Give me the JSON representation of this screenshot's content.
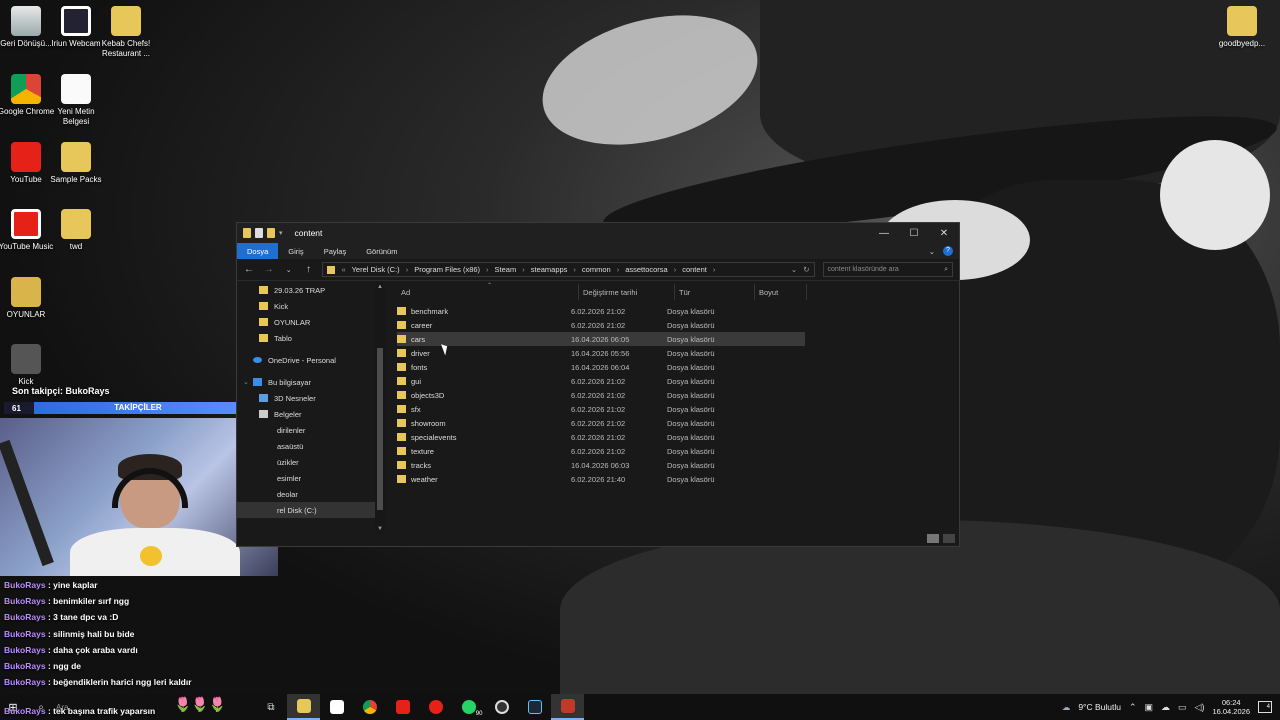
{
  "desktop_icons": [
    {
      "label": "Geri Dönüşü...",
      "icon": "recycle-bin-icon"
    },
    {
      "label": "Iriun Webcam",
      "icon": "webcam-icon"
    },
    {
      "label": "Kebab Chefs! Restaurant ...",
      "icon": "folder-icon"
    },
    {
      "label": "Google Chrome",
      "icon": "chrome-icon"
    },
    {
      "label": "Yeni Metin Belgesi",
      "icon": "text-document-icon"
    },
    {
      "label": "YouTube",
      "icon": "youtube-icon"
    },
    {
      "label": "Sample Packs",
      "icon": "folder-icon"
    },
    {
      "label": "YouTube Music",
      "icon": "youtube-music-icon"
    },
    {
      "label": "twd",
      "icon": "folder-icon"
    },
    {
      "label": "OYUNLAR",
      "icon": "folder-icon"
    },
    {
      "label": "Kick",
      "icon": "kick-icon"
    },
    {
      "label": "goodbyedp...",
      "icon": "folder-icon"
    }
  ],
  "stream_overlay": {
    "follower_title": "Son takipçi: BukoRays",
    "follower_count": "61",
    "follower_label": "TAKİPÇİLER",
    "follower_goal": "100"
  },
  "chat": [
    {
      "user": "BukoRays",
      "msg": ": yine kaplar"
    },
    {
      "user": "BukoRays",
      "msg": ": benimkiler sırf ngg"
    },
    {
      "user": "BukoRays",
      "msg": ": 3 tane dpc va :D"
    },
    {
      "user": "BukoRays",
      "msg": ": silinmiş hali bu bide"
    },
    {
      "user": "BukoRays",
      "msg": ": daha çok araba vardı"
    },
    {
      "user": "BukoRays",
      "msg": ": ngg de"
    },
    {
      "user": "BukoRays",
      "msg": ": beğendiklerin harici ngg leri kaldır"
    },
    {
      "user": "BukoRays",
      "msg": ": bi tane shuto haritası var onu indir"
    },
    {
      "user": "BukoRays",
      "msg": ": tek başına trafik yaparsın"
    }
  ],
  "explorer": {
    "title": "content",
    "ribbon_tabs": [
      "Dosya",
      "Giriş",
      "Paylaş",
      "Görünüm"
    ],
    "path": [
      "Yerel Disk (C:)",
      "Program Files (x86)",
      "Steam",
      "steamapps",
      "common",
      "assettocorsa",
      "content"
    ],
    "search_placeholder": "content klasöründe ara",
    "columns": [
      "Ad",
      "Değiştirme tarihi",
      "Tür",
      "Boyut"
    ],
    "nav_items": [
      {
        "label": "29.03.26 TRAP",
        "icon": "folder-icon"
      },
      {
        "label": "Kick",
        "icon": "folder-icon"
      },
      {
        "label": "OYUNLAR",
        "icon": "folder-icon"
      },
      {
        "label": "Tablo",
        "icon": "folder-icon"
      },
      {
        "label": "OneDrive - Personal",
        "icon": "onedrive-icon"
      },
      {
        "label": "Bu bilgisayar",
        "icon": "pc-icon"
      },
      {
        "label": "3D Nesneler",
        "icon": "cube-icon"
      },
      {
        "label": "Belgeler",
        "icon": "documents-icon"
      },
      {
        "label": "dirilenler",
        "icon": "downloads-icon"
      },
      {
        "label": "asaüstü",
        "icon": "desktop-icon"
      },
      {
        "label": "üzikler",
        "icon": "music-icon"
      },
      {
        "label": "esimler",
        "icon": "pictures-icon"
      },
      {
        "label": "deolar",
        "icon": "videos-icon"
      },
      {
        "label": "rel Disk (C:)",
        "icon": "disk-icon"
      }
    ],
    "files": [
      {
        "name": "benchmark",
        "date": "6.02.2026 21:02",
        "type": "Dosya klasörü"
      },
      {
        "name": "career",
        "date": "6.02.2026 21:02",
        "type": "Dosya klasörü"
      },
      {
        "name": "cars",
        "date": "16.04.2026 06:05",
        "type": "Dosya klasörü"
      },
      {
        "name": "driver",
        "date": "16.04.2026 05:56",
        "type": "Dosya klasörü"
      },
      {
        "name": "fonts",
        "date": "16.04.2026 06:04",
        "type": "Dosya klasörü"
      },
      {
        "name": "gui",
        "date": "6.02.2026 21:02",
        "type": "Dosya klasörü"
      },
      {
        "name": "objects3D",
        "date": "6.02.2026 21:02",
        "type": "Dosya klasörü"
      },
      {
        "name": "sfx",
        "date": "6.02.2026 21:02",
        "type": "Dosya klasörü"
      },
      {
        "name": "showroom",
        "date": "6.02.2026 21:02",
        "type": "Dosya klasörü"
      },
      {
        "name": "specialevents",
        "date": "6.02.2026 21:02",
        "type": "Dosya klasörü"
      },
      {
        "name": "texture",
        "date": "6.02.2026 21:02",
        "type": "Dosya klasörü"
      },
      {
        "name": "tracks",
        "date": "16.04.2026 06:03",
        "type": "Dosya klasörü"
      },
      {
        "name": "weather",
        "date": "6.02.2026 21:40",
        "type": "Dosya klasörü"
      }
    ]
  },
  "taskbar": {
    "weather": "9°C Bulutlu",
    "time": "06:24",
    "date": "16.04.2026",
    "whatsapp_badge": "90",
    "notification_count": "4",
    "search_hint": "Ara"
  }
}
